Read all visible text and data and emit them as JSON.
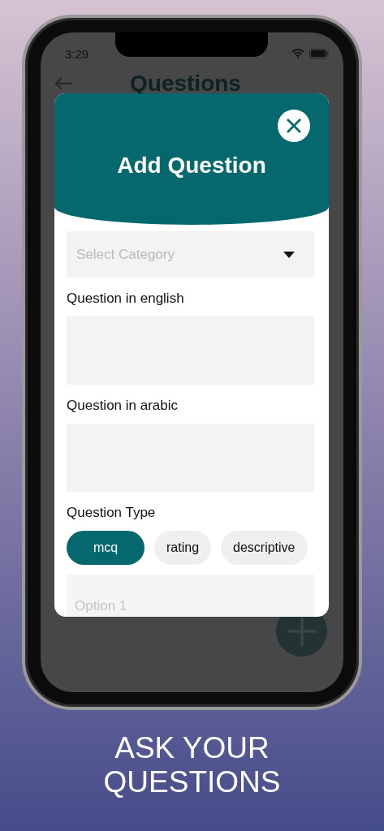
{
  "status_bar": {
    "time": "3:29"
  },
  "header": {
    "title": "Questions"
  },
  "modal": {
    "title": "Add Question",
    "category": {
      "placeholder": "Select Category"
    },
    "fields": [
      {
        "label": "Question in english"
      },
      {
        "label": "Question in arabic"
      }
    ],
    "type_label": "Question Type",
    "types": [
      {
        "label": "mcq",
        "selected": true
      },
      {
        "label": "rating",
        "selected": false
      },
      {
        "label": "descriptive",
        "selected": false
      }
    ],
    "option": {
      "placeholder": "Option 1"
    }
  },
  "caption": "ASK YOUR QUESTIONS"
}
